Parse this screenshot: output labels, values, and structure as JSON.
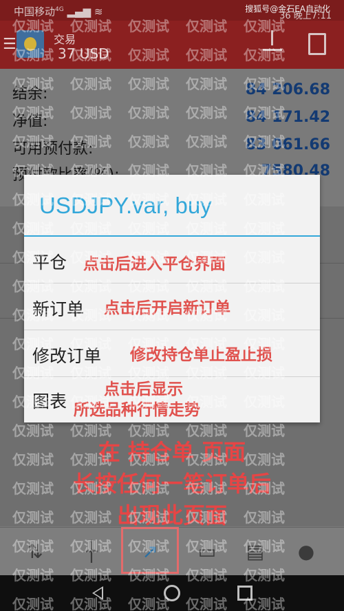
{
  "status_bar": {
    "carrier": "中国移动",
    "network": "4G",
    "battery": "36",
    "time": "晚上7:11",
    "source_tag": "搜狐号@金石EA自动化"
  },
  "app_bar": {
    "title": "交易",
    "account": "37      USD"
  },
  "summary": [
    {
      "label": "结余:",
      "value": "84 206.68"
    },
    {
      "label": "净值:",
      "value": "84 171.42"
    },
    {
      "label": "可用预付款:",
      "value": "83 061.66"
    },
    {
      "label": "预付款比率(%):",
      "value": "7580.48"
    }
  ],
  "dialog": {
    "title": "USDJPY.var, buy",
    "items": [
      {
        "label": "平仓",
        "note": "点击后进入平仓界面"
      },
      {
        "label": "新订单",
        "note": "点击后开启新订单"
      },
      {
        "label": "修改订单",
        "note": "修改持仓单止盈止损"
      },
      {
        "label": "图表",
        "note_line1": "点击后显示",
        "note_line2": "所选品种行情走势"
      }
    ]
  },
  "instructions": {
    "line1": "在 持仓单 页面",
    "line2": "长按任何一笔订单后",
    "line3": "出现此页面"
  },
  "bottom_nav": [
    {
      "icon": "quotes-icon"
    },
    {
      "icon": "chart-icon"
    },
    {
      "icon": "trade-icon",
      "highlighted": true
    },
    {
      "icon": "history-icon"
    },
    {
      "icon": "journal-icon"
    },
    {
      "icon": "chat-icon"
    }
  ],
  "watermark": "仅测试",
  "colors": {
    "accent": "#33a7d9",
    "annotation": "#e0524e",
    "appbar": "#8b2020"
  }
}
